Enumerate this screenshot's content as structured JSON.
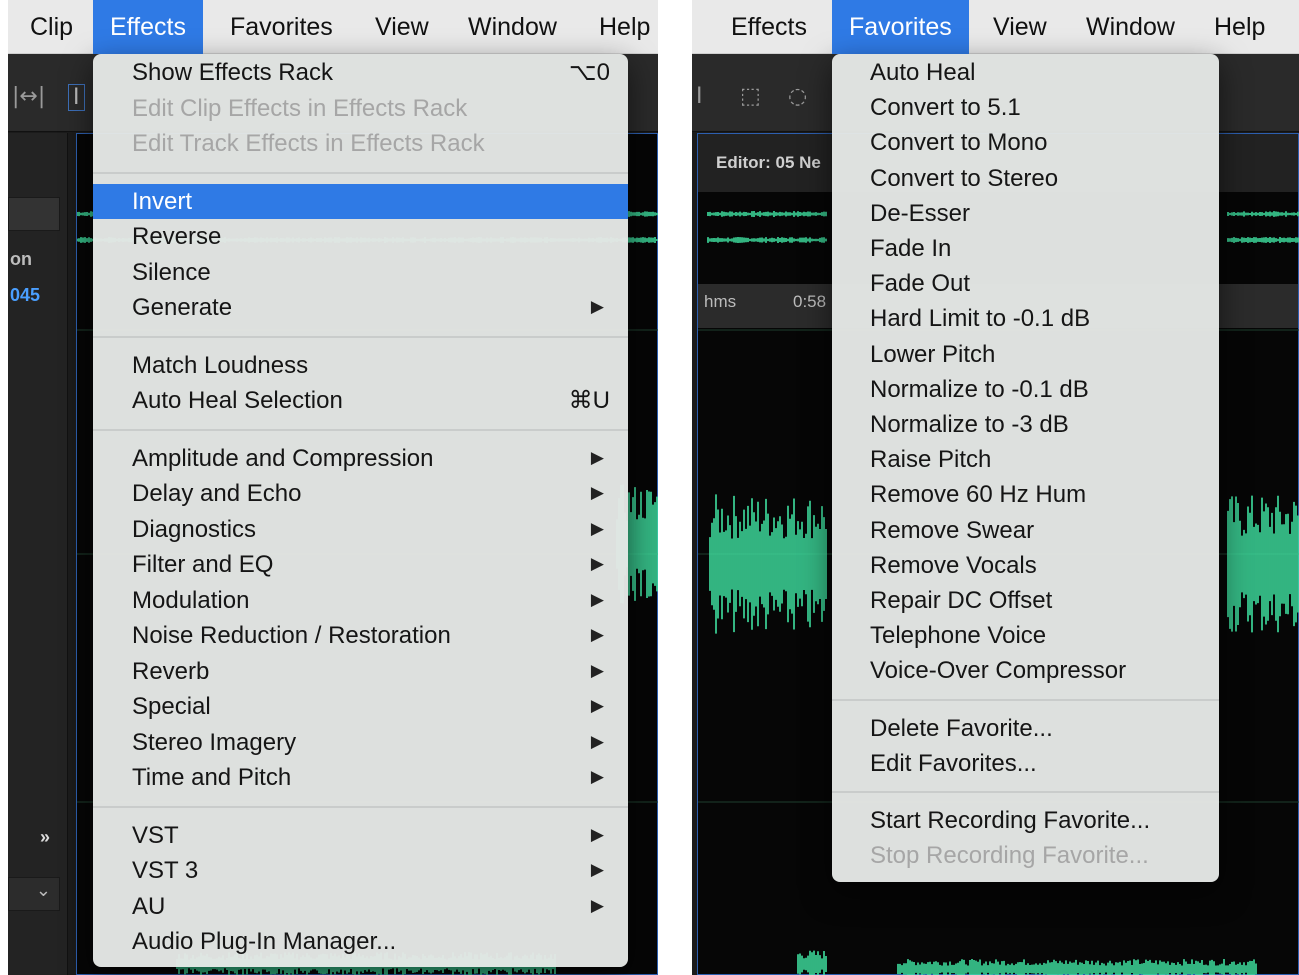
{
  "left": {
    "menubar": [
      {
        "label": "Clip",
        "active": false
      },
      {
        "label": "Effects",
        "active": true
      },
      {
        "label": "Favorites",
        "active": false
      },
      {
        "label": "View",
        "active": false
      },
      {
        "label": "Window",
        "active": false
      },
      {
        "label": "Help",
        "active": false
      }
    ],
    "side_text": {
      "row1": "on",
      "row2": "045"
    },
    "effects_menu": {
      "items": [
        {
          "label": "Show Effects Rack",
          "shortcut": "⌥0",
          "disabled": false
        },
        {
          "label": "Edit Clip Effects in Effects Rack",
          "disabled": true
        },
        {
          "label": "Edit Track Effects in Effects Rack",
          "disabled": true
        },
        {
          "separator": true
        },
        {
          "label": "Invert",
          "highlighted": true
        },
        {
          "label": "Reverse"
        },
        {
          "label": "Silence"
        },
        {
          "label": "Generate",
          "submenu": true
        },
        {
          "separator": true
        },
        {
          "label": "Match Loudness"
        },
        {
          "label": "Auto Heal Selection",
          "shortcut": "⌘U"
        },
        {
          "separator": true
        },
        {
          "label": "Amplitude and Compression",
          "submenu": true
        },
        {
          "label": "Delay and Echo",
          "submenu": true
        },
        {
          "label": "Diagnostics",
          "submenu": true
        },
        {
          "label": "Filter and EQ",
          "submenu": true
        },
        {
          "label": "Modulation",
          "submenu": true
        },
        {
          "label": "Noise Reduction / Restoration",
          "submenu": true
        },
        {
          "label": "Reverb",
          "submenu": true
        },
        {
          "label": "Special",
          "submenu": true
        },
        {
          "label": "Stereo Imagery",
          "submenu": true
        },
        {
          "label": "Time and Pitch",
          "submenu": true
        },
        {
          "separator": true
        },
        {
          "label": "VST",
          "submenu": true
        },
        {
          "label": "VST 3",
          "submenu": true
        },
        {
          "label": "AU",
          "submenu": true
        },
        {
          "label": "Audio Plug-In Manager..."
        }
      ]
    }
  },
  "right": {
    "menubar": [
      {
        "label": "Effects",
        "active": false
      },
      {
        "label": "Favorites",
        "active": true
      },
      {
        "label": "View",
        "active": false
      },
      {
        "label": "Window",
        "active": false
      },
      {
        "label": "Help",
        "active": false
      }
    ],
    "editor_title": "Editor: 05 Ne",
    "ruler": {
      "unit": "hms",
      "time": "0:58"
    },
    "favorites_menu": {
      "items": [
        {
          "label": "Auto Heal"
        },
        {
          "label": "Convert to 5.1"
        },
        {
          "label": "Convert to Mono"
        },
        {
          "label": "Convert to Stereo"
        },
        {
          "label": "De-Esser"
        },
        {
          "label": "Fade In"
        },
        {
          "label": "Fade Out"
        },
        {
          "label": "Hard Limit to -0.1 dB"
        },
        {
          "label": "Lower Pitch"
        },
        {
          "label": "Normalize to -0.1 dB"
        },
        {
          "label": "Normalize to -3 dB"
        },
        {
          "label": "Raise Pitch"
        },
        {
          "label": "Remove 60 Hz Hum"
        },
        {
          "label": "Remove Swear"
        },
        {
          "label": "Remove Vocals"
        },
        {
          "label": "Repair DC Offset"
        },
        {
          "label": "Telephone Voice"
        },
        {
          "label": "Voice-Over Compressor"
        },
        {
          "separator": true
        },
        {
          "label": "Delete Favorite..."
        },
        {
          "label": "Edit Favorites..."
        },
        {
          "separator": true
        },
        {
          "label": "Start Recording Favorite..."
        },
        {
          "label": "Stop Recording Favorite...",
          "disabled": true
        }
      ]
    }
  },
  "colors": {
    "accent": "#2f7ae5",
    "waveform": "#3fe0a0",
    "disabled_text": "#a6a6a6"
  },
  "icons": {
    "submenu_arrow": "▶",
    "sidebar_expand": "»",
    "sidebar_dropdown": "⌄"
  }
}
